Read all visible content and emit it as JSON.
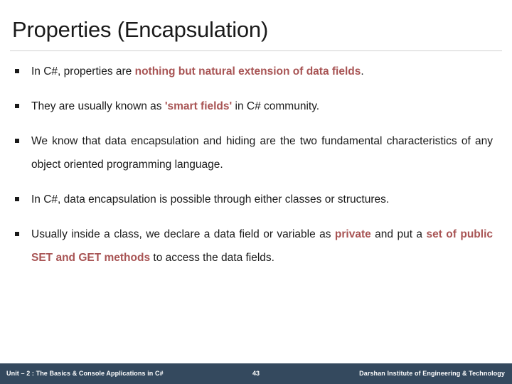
{
  "slide": {
    "title": "Properties (Encapsulation)",
    "bullet_marker_glyph": "square-bullet",
    "accent_color": "#a85454",
    "text_color": "#1a1a1a",
    "footer_bg_color": "#34495e",
    "rule_color": "#d0d0d0"
  },
  "bullets": [
    {
      "id": "bullet-1",
      "parts": [
        {
          "text": "In C#, properties are ",
          "style": "normal"
        },
        {
          "text": "nothing but natural extension of data fields",
          "style": "accent"
        },
        {
          "text": ".",
          "style": "normal"
        }
      ]
    },
    {
      "id": "bullet-2",
      "parts": [
        {
          "text": "They are usually known as ",
          "style": "normal"
        },
        {
          "text": "'smart fields'",
          "style": "accent"
        },
        {
          "text": " in C# community.",
          "style": "normal"
        }
      ]
    },
    {
      "id": "bullet-3",
      "parts": [
        {
          "text": "We know that data encapsulation and hiding are the two fundamental characteristics of any object oriented programming language.",
          "style": "normal"
        }
      ]
    },
    {
      "id": "bullet-4",
      "parts": [
        {
          "text": "In C#, data encapsulation is possible through either classes or structures.",
          "style": "normal"
        }
      ]
    },
    {
      "id": "bullet-5",
      "parts": [
        {
          "text": "Usually inside a class, we declare a data field or variable as ",
          "style": "normal"
        },
        {
          "text": "private",
          "style": "accent"
        },
        {
          "text": " and put a ",
          "style": "normal"
        },
        {
          "text": "set of public SET and GET methods",
          "style": "accent"
        },
        {
          "text": " to access the data fields.",
          "style": "normal"
        }
      ]
    }
  ],
  "footer": {
    "left": "Unit – 2 : The Basics & Console Applications in C#",
    "page_number": "43",
    "right": "Darshan Institute of Engineering & Technology"
  }
}
